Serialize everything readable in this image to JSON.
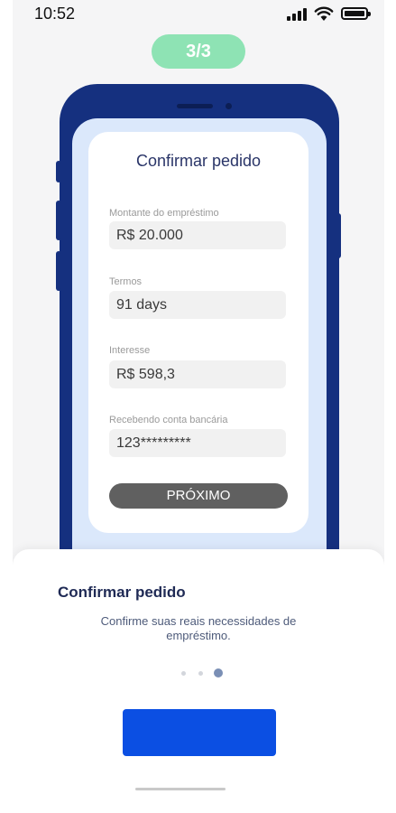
{
  "status_bar": {
    "time": "10:52"
  },
  "step": {
    "label": "3/3"
  },
  "phone": {
    "card_title": "Confirmar pedido",
    "fields": [
      {
        "label": "Montante do empréstimo",
        "value": "R$ 20.000"
      },
      {
        "label": "Termos",
        "value": "91 days"
      },
      {
        "label": "Interesse",
        "value": "R$ 598,3"
      },
      {
        "label": "Recebendo conta bancária",
        "value": "123*********"
      }
    ],
    "next_label": "PRÓXIMO"
  },
  "sheet": {
    "title": "Confirmar pedido",
    "description": "Confirme suas reais necessidades de empréstimo.",
    "page_count": 3,
    "active_page": 3
  },
  "colors": {
    "pill": "#8ee3b4",
    "phone_body": "#15307f",
    "primary_button": "#0b4fe3",
    "active_dot": "#7a8fb5"
  }
}
